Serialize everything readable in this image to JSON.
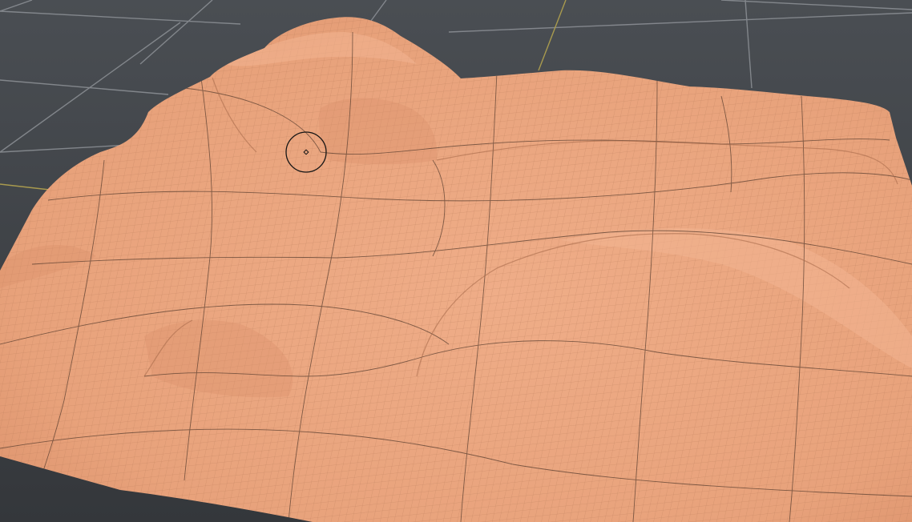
{
  "viewport": {
    "background_top": "#4a4e53",
    "background_bottom": "#34373b",
    "grid_line_color": "#8d9196",
    "axis_line_color": "#a89a4e",
    "mesh_fill": "#eaa37c",
    "mesh_fill_shadow": "#d98f69",
    "wire_color_fine": "#b57a58",
    "wire_color_major": "#5a3f30",
    "brush_cursor_color": "#151515"
  }
}
